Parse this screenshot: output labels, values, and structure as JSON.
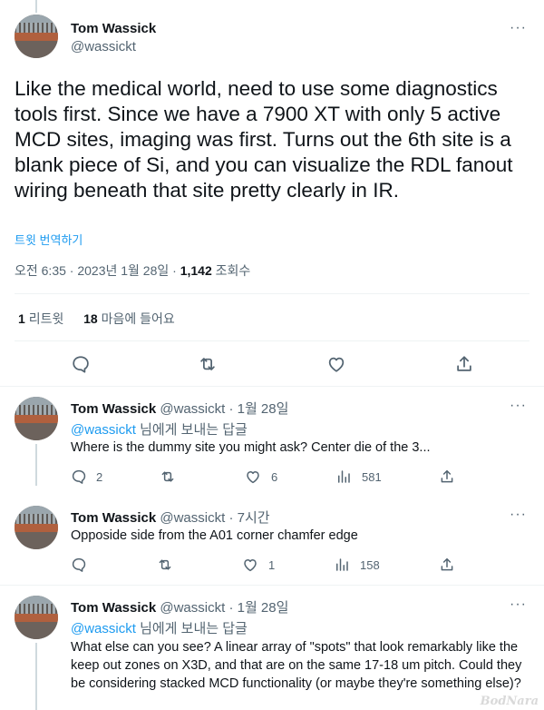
{
  "main_tweet": {
    "author_name": "Tom Wassick",
    "author_handle": "@wassickt",
    "text": "Like the medical world, need to use some diagnostics tools first.  Since we have a 7900 XT with only 5 active MCD sites,  imaging was first.  Turns out the 6th site is a blank piece of Si, and you can visualize the RDL fanout wiring beneath that site pretty clearly in IR.",
    "translate_label": "트윗 번역하기",
    "time": "오전 6:35 · 2023년 1월 28일",
    "views_count": "1,142",
    "views_label": "조회수",
    "retweets_count": "1",
    "retweets_label": "리트윗",
    "likes_count": "18",
    "likes_label": "마음에 들어요"
  },
  "replies": [
    {
      "author_name": "Tom Wassick",
      "meta": "@wassickt · 1월 28일",
      "reply_to_handle": "@wassickt",
      "reply_to_suffix": " 님에게 보내는 답글",
      "text": "Where is the dummy site you might ask?  Center die of the 3...",
      "reply_count": "2",
      "retweet_count": "",
      "like_count": "6",
      "view_count": "581"
    },
    {
      "author_name": "Tom Wassick",
      "meta": "@wassickt · 7시간",
      "text": "Opposide side from the A01 corner chamfer edge",
      "reply_count": "",
      "retweet_count": "",
      "like_count": "1",
      "view_count": "158"
    },
    {
      "author_name": "Tom Wassick",
      "meta": "@wassickt · 1월 28일",
      "reply_to_handle": "@wassickt",
      "reply_to_suffix": " 님에게 보내는 답글",
      "text": "What else can you see?   A linear array of \"spots\" that look remarkably like the keep out zones on X3D, and that are on the same 17-18 um pitch.  Could they be considering stacked MCD functionality (or maybe they're something else)?"
    }
  ],
  "more_glyph": "···",
  "watermark": "BodNara",
  "colors": {
    "accent": "#1d9bf0",
    "secondary_text": "#536471",
    "divider": "#eff3f4"
  }
}
